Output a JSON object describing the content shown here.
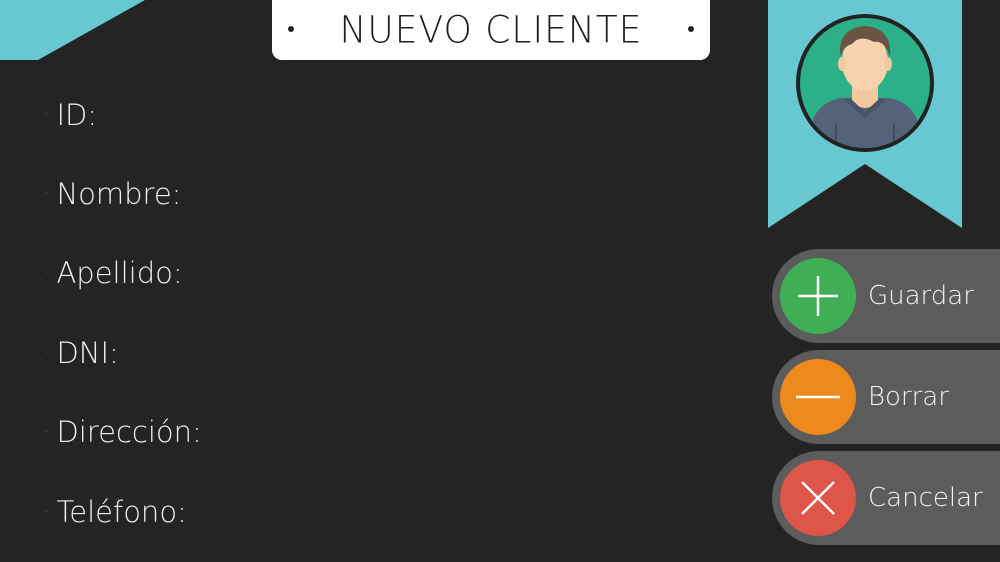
{
  "window": {
    "title": "NUEVO CLIENTE"
  },
  "form": {
    "fields": [
      {
        "label": "ID:"
      },
      {
        "label": "Nombre:"
      },
      {
        "label": "Apellido:"
      },
      {
        "label": "DNI:"
      },
      {
        "label": "Dirección:"
      },
      {
        "label": "Teléfono:"
      }
    ],
    "bullet": "·"
  },
  "actions": {
    "save": {
      "label": "Guardar",
      "icon": "plus-icon",
      "color": "#3fae54"
    },
    "delete": {
      "label": "Borrar",
      "icon": "minus-icon",
      "color": "#ee8a1d"
    },
    "cancel": {
      "label": "Cancelar",
      "icon": "close-icon",
      "color": "#de5549"
    }
  },
  "colors": {
    "background": "#242424",
    "accent": "#68c8d1",
    "button_bg": "#5c5c5c",
    "avatar_bg": "#2bb088",
    "bullet": "#e87b6a"
  }
}
